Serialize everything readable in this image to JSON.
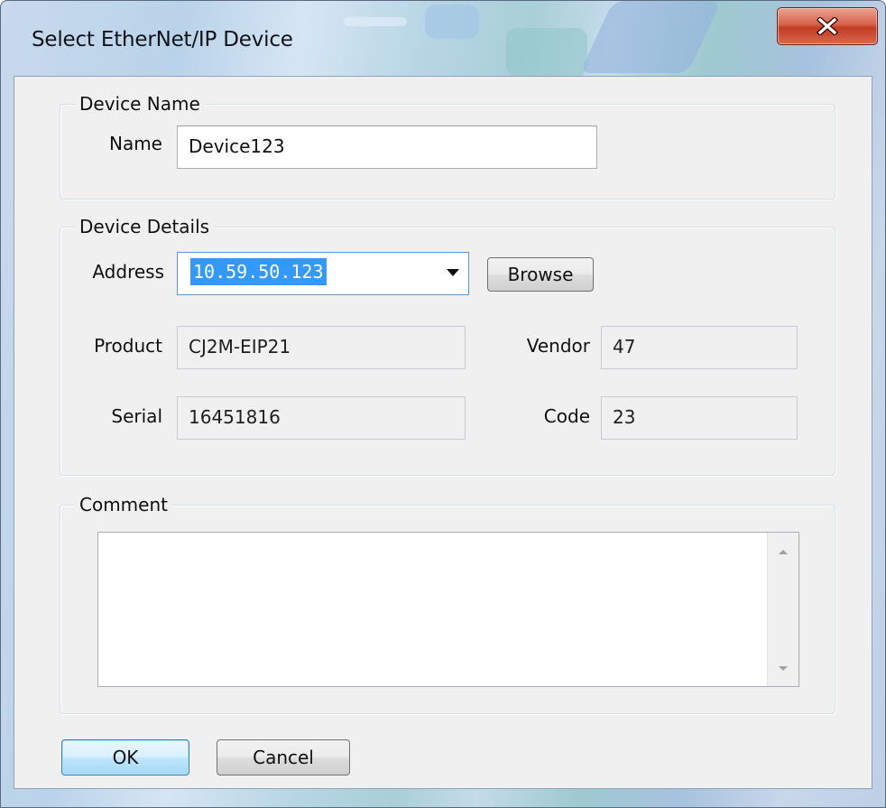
{
  "window": {
    "title": "Select EtherNet/IP Device"
  },
  "device_name": {
    "legend": "Device Name",
    "name_label": "Name",
    "name_value": "Device123"
  },
  "device_details": {
    "legend": "Device Details",
    "address_label": "Address",
    "address_value": "10.59.50.123",
    "browse_label": "Browse",
    "product_label": "Product",
    "product_value": "CJ2M-EIP21",
    "vendor_label": "Vendor",
    "vendor_value": "47",
    "serial_label": "Serial",
    "serial_value": "16451816",
    "code_label": "Code",
    "code_value": "23"
  },
  "comment": {
    "legend": "Comment",
    "value": ""
  },
  "buttons": {
    "ok_label": "OK",
    "cancel_label": "Cancel"
  },
  "icons": {
    "close": "close-x-icon",
    "dropdown": "chevron-down-icon",
    "scroll_up": "scroll-up-arrow-icon",
    "scroll_down": "scroll-down-arrow-icon"
  },
  "colors": {
    "selection_highlight": "#3399ff",
    "close_button": "#c94a31",
    "dialog_face": "#f0f0f0"
  }
}
